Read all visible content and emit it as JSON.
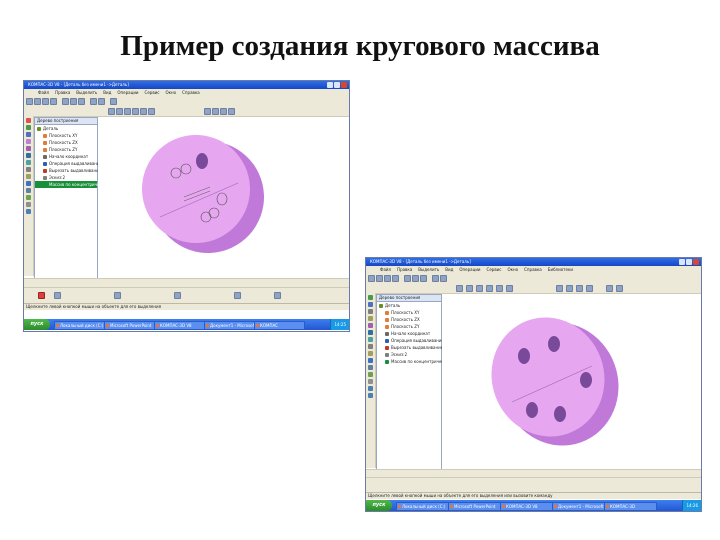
{
  "slide_title": "Пример создания кругового массива",
  "windows": [
    {
      "id": "win1",
      "title": "КОМПАС-3D V8 - [Деталь без имени1 ->Деталь]",
      "menu": [
        "Файл",
        "Правка",
        "Выделить",
        "Вид",
        "Операции",
        "Сервис",
        "Окно",
        "Справка"
      ],
      "tree_header": "Дерево построения",
      "tree_items": [
        "Деталь",
        "Плоскость XY",
        "Плоскость ZX",
        "Плоскость ZY",
        "Начало координат",
        "Операция выдавливания:1",
        "Вырезать выдавливанием:1",
        "Эскиз:2",
        "Массив по концентрической сетке:1"
      ],
      "tree_selected": 8,
      "statusbar": "Щелкните левой кнопкой мыши на объекте для его выделения",
      "start_label": "пуск",
      "tasks": [
        "Локальный диск (C:)",
        "Microsoft PowerPoint",
        "КОМПАС-3D V8",
        "Документ1 - Microsoft Word",
        "КОМПАС"
      ],
      "tray": "14:25"
    },
    {
      "id": "win2",
      "title": "КОМПАС-3D V8 - [Деталь без имени1 ->Деталь]",
      "menu": [
        "Файл",
        "Правка",
        "Выделить",
        "Вид",
        "Операции",
        "Сервис",
        "Окно",
        "Справка",
        "Библиотеки"
      ],
      "tree_header": "Дерево построения",
      "tree_items": [
        "Деталь",
        "Плоскость XY",
        "Плоскость ZX",
        "Плоскость ZY",
        "Начало координат",
        "Операция выдавливания:1",
        "Вырезать выдавливанием:1",
        "Эскиз:2",
        "Массив по концентрической сетке:1"
      ],
      "tree_selected": -1,
      "statusbar": "Щелкните левой кнопкой мыши на объекте для его выделения или вызовите команду",
      "start_label": "пуск",
      "tasks": [
        "Локальный диск (C:)",
        "Microsoft PowerPoint",
        "КОМПАС-3D V8",
        "Документ1 - Microsoft Word",
        "КОМПАС-3D"
      ],
      "tray": "14:26"
    }
  ],
  "colors": {
    "accent_blue": "#1546c4",
    "part_face": "#e6a6f0",
    "part_side": "#c079d8",
    "hole": "#7a4a9a",
    "selected_row": "#1a8f3a"
  }
}
